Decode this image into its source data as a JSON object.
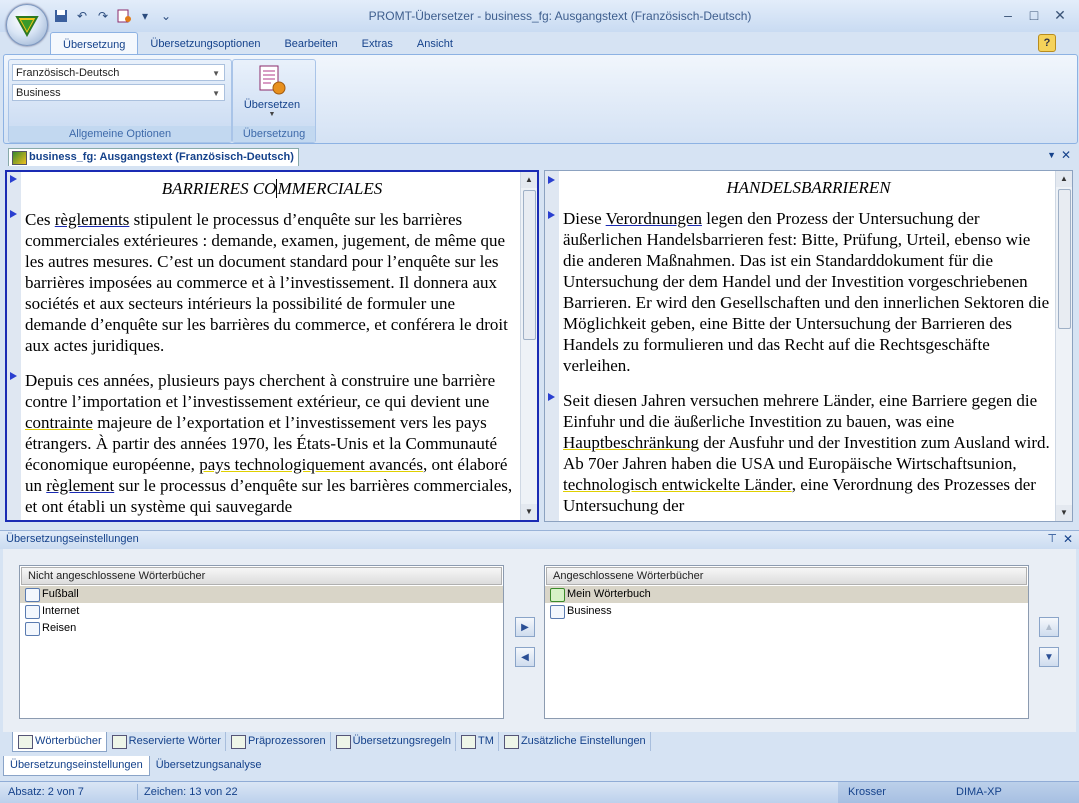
{
  "window": {
    "title": "PROMT-Übersetzer - business_fg: Ausgangstext (Französisch-Deutsch)",
    "minimize": "–",
    "maximize": "□",
    "close": "✕"
  },
  "qat": {
    "customize": "▾"
  },
  "tabs": [
    "Übersetzung",
    "Übersetzungsoptionen",
    "Bearbeiten",
    "Extras",
    "Ansicht"
  ],
  "help": "?",
  "ribbon": {
    "lang_pair": "Französisch-Deutsch",
    "subject": "Business",
    "general_group_label": "Allgemeine Optionen",
    "translate_label": "Übersetzen",
    "translate_group_label": "Übersetzung"
  },
  "document": {
    "tab_label": "business_fg: Ausgangstext (Französisch-Deutsch)",
    "source": {
      "title_pre": "BARRIERES CO",
      "title_post": "MMERCIALES",
      "p1": [
        "Ces ",
        "règlements",
        " stipulent le processus d’enquête sur les barrières commerciales extérieures : demande, examen, jugement, de même que les autres mesures. C’est un document standard pour l’enquête sur les barrières imposées au commerce et à l’investissement. Il donnera aux sociétés et aux secteurs intérieurs la possibilité de formuler une demande d’enquête sur les barrières du commerce, et conférera le droit aux actes juridiques."
      ],
      "p2": [
        "Depuis ces années, plusieurs pays cherchent à construire une barrière contre l’importation et l’investissement extérieur, ce qui devient une ",
        "contrainte",
        " majeure de l’exportation et l’investissement vers les pays étrangers. À partir des années 1970, les États-Unis et la Communauté économique européenne, ",
        "pays technologiquement avancés",
        ", ont élaboré un ",
        "règlement",
        " sur le processus d’enquête sur les barrières commerciales, et ont établi un système qui sauvegarde"
      ]
    },
    "target": {
      "title": "HANDELSBARRIEREN",
      "p1": [
        "Diese ",
        "Verordnungen",
        " legen den Prozess der Untersuchung der äußerlichen Handelsbarrieren fest: Bitte, Prüfung, Urteil, ebenso wie die anderen Maßnahmen. Das ist ein Standarddokument für die Untersuchung der dem Handel und der Investition vorgeschriebenen Barrieren. Er wird den Gesellschaften und den innerlichen Sektoren die Möglichkeit geben, eine Bitte der Untersuchung der Barrieren des Handels zu formulieren und das Recht auf die Rechtsgeschäfte verleihen."
      ],
      "p2": [
        "Seit diesen Jahren versuchen mehrere Länder, eine Barriere gegen die Einfuhr und die äußerliche Investition zu bauen, was eine ",
        "Hauptbeschränkung",
        " der Ausfuhr und der Investition zum Ausland wird. Ab 70er Jahren haben die USA und Europäische Wirtschaftsunion, ",
        "technologisch entwickelte Länder",
        ", eine Verordnung des Prozesses der Untersuchung der"
      ]
    }
  },
  "settings": {
    "title": "Übersetzungseinstellungen",
    "pin": "⊤",
    "close": "✕",
    "left_header": "Nicht angeschlossene Wörterbücher",
    "left_items": [
      "Fußball",
      "Internet",
      "Reisen"
    ],
    "right_header": "Angeschlossene Wörterbücher",
    "right_items": [
      "Mein Wörterbuch",
      "Business"
    ],
    "add_btn": "▶",
    "remove_btn": "◀",
    "up_btn": "▲",
    "down_btn": "▼"
  },
  "bottom_tabs": [
    "Wörterbücher",
    "Reservierte Wörter",
    "Präprozessoren",
    "Übersetzungsregeln",
    "TM",
    "Zusätzliche Einstellungen"
  ],
  "panel_tabs": [
    "Übersetzungseinstellungen",
    "Übersetzungsanalyse"
  ],
  "status": {
    "paragraph": "Absatz: 2 von 7",
    "chars": "Zeichen: 13 von 22",
    "user": "Krosser",
    "machine": "DIMA-XP"
  }
}
